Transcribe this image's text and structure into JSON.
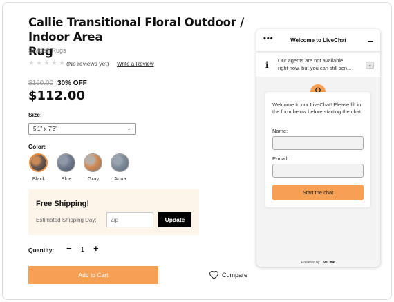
{
  "product": {
    "title_line1": "Callie Transitional Floral Outdoor / Indoor Area",
    "title_line2": "Rug",
    "brand": "Shadeh Rugs",
    "reviews_text": "(No reviews yet)",
    "write_review": "Write a Review",
    "rating_stars": 0,
    "old_price": "$160.00",
    "discount": "30% OFF",
    "price": "$112.00"
  },
  "size": {
    "label": "Size:",
    "selected": "5'1\" x 7'3\""
  },
  "color": {
    "label": "Color:",
    "swatches": [
      {
        "name": "Black",
        "selected": true,
        "colors": [
          "#c98a55",
          "#6b5a50",
          "#3a3432"
        ]
      },
      {
        "name": "Blue",
        "selected": false,
        "colors": [
          "#8e97a8",
          "#6f7a8c",
          "#4c5363"
        ]
      },
      {
        "name": "Gray",
        "selected": false,
        "colors": [
          "#b8b0a8",
          "#d4894f",
          "#7a7470"
        ]
      },
      {
        "name": "Aqua",
        "selected": false,
        "colors": [
          "#9aa4b0",
          "#7f8c9a",
          "#5c6774"
        ]
      }
    ]
  },
  "shipping": {
    "title": "Free Shipping!",
    "estimated_label": "Estimated Shipping Day:",
    "zip_placeholder": "Zip",
    "update_label": "Update"
  },
  "quantity": {
    "label": "Quantity:",
    "minus": "−",
    "value": "1",
    "plus": "+"
  },
  "actions": {
    "add_to_cart": "Add to Cart",
    "compare": "Compare"
  },
  "chat": {
    "menu": "•••",
    "title": "Welcome to LiveChat",
    "notice_line1": "Our agents are not available",
    "notice_line2": "right now, but you can still sen...",
    "info": "i",
    "expand": "⌄",
    "welcome": "Welcome to our LiveChat! Please fill in the form below before starting the chat.",
    "name_label": "Name:",
    "email_label": "E-mail:",
    "start_label": "Start the chat",
    "footer_prefix": "Powered by",
    "footer_brand": "LiveChat"
  },
  "colors": {
    "accent": "#f5a054",
    "shipping_bg": "#fdf5ea"
  }
}
